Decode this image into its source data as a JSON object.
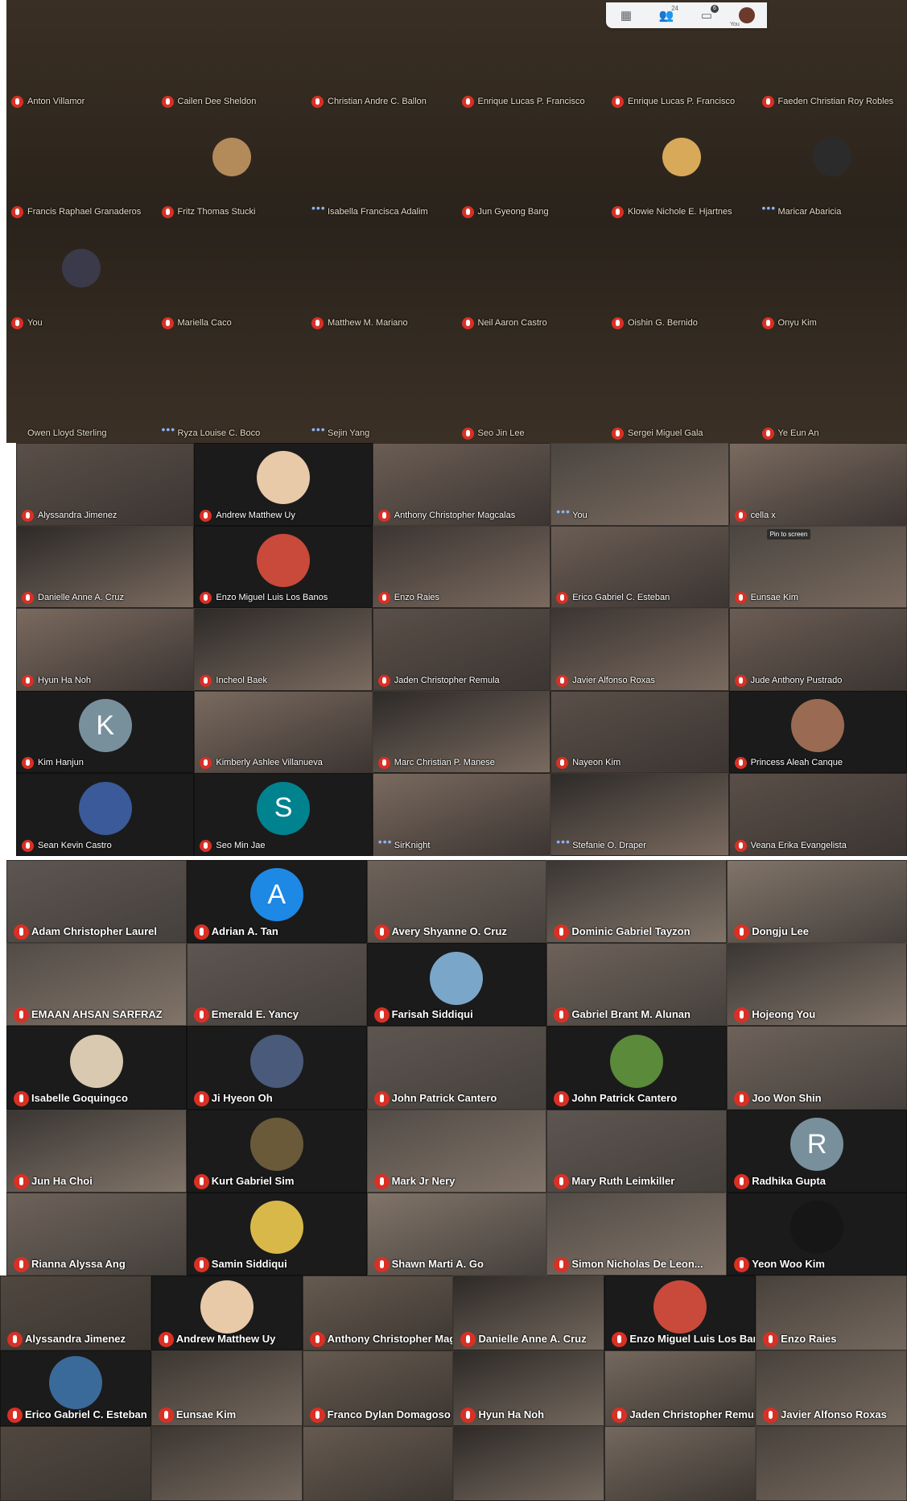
{
  "toolbar": {
    "people_count": "24",
    "chat_count": "6",
    "you_label": "You",
    "icons": [
      "grid-icon",
      "people-icon",
      "chat-icon",
      "self-avatar"
    ]
  },
  "screens": [
    {
      "cols": 6,
      "tiles": [
        {
          "name": "Anton Villamor",
          "status": "muted"
        },
        {
          "name": "Cailen Dee Sheldon",
          "status": "muted"
        },
        {
          "name": "Christian Andre C. Ballon",
          "status": "muted"
        },
        {
          "name": "Enrique Lucas P. Francisco",
          "status": "muted"
        },
        {
          "name": "Enrique Lucas P. Francisco",
          "status": "muted"
        },
        {
          "name": "Faeden Christian Roy Robles",
          "status": "muted"
        },
        {
          "name": "Francis Raphael Granaderos",
          "status": "muted"
        },
        {
          "name": "Fritz Thomas Stucki",
          "status": "muted",
          "avatar_color": "#b38a5a"
        },
        {
          "name": "Isabella Francisca Adalim",
          "status": "speaking"
        },
        {
          "name": "Jun Gyeong Bang",
          "status": "muted"
        },
        {
          "name": "Klowie Nichole E. Hjartnes",
          "status": "muted",
          "avatar_color": "#d9a95a"
        },
        {
          "name": "Maricar Abaricia",
          "status": "speaking",
          "avatar_color": "#2b2b2b"
        },
        {
          "name": "You",
          "status": "muted",
          "avatar_color": "#3a3a4a"
        },
        {
          "name": "Mariella Caco",
          "status": "muted"
        },
        {
          "name": "Matthew M. Mariano",
          "status": "muted"
        },
        {
          "name": "Neil Aaron Castro",
          "status": "muted"
        },
        {
          "name": "Oishin G. Bernido",
          "status": "muted"
        },
        {
          "name": "Onyu Kim",
          "status": "muted"
        },
        {
          "name": "Owen Lloyd Sterling",
          "status": "none"
        },
        {
          "name": "Ryza Louise C. Boco",
          "status": "speaking"
        },
        {
          "name": "Sejin Yang",
          "status": "speaking"
        },
        {
          "name": "Seo Jin Lee",
          "status": "muted"
        },
        {
          "name": "Sergei Miguel Gala",
          "status": "muted"
        },
        {
          "name": "Ye Eun An",
          "status": "muted"
        }
      ]
    },
    {
      "cols": 5,
      "tiles": [
        {
          "name": "Alyssandra Jimenez",
          "status": "muted"
        },
        {
          "name": "Andrew Matthew Uy",
          "status": "muted",
          "avatar_color": "#e8c9a8"
        },
        {
          "name": "Anthony Christopher Magcalas",
          "status": "muted"
        },
        {
          "name": "You",
          "status": "speaking"
        },
        {
          "name": "cella x",
          "status": "muted"
        },
        {
          "name": "Danielle Anne A. Cruz",
          "status": "muted"
        },
        {
          "name": "Enzo Miguel Luis Los Banos",
          "status": "muted",
          "avatar_color": "#c94a3a"
        },
        {
          "name": "Enzo Raies",
          "status": "muted"
        },
        {
          "name": "Erico Gabriel C. Esteban",
          "status": "muted"
        },
        {
          "name": "Eunsae Kim",
          "status": "muted",
          "tooltip": "Pin to screen"
        },
        {
          "name": "Hyun Ha Noh",
          "status": "muted"
        },
        {
          "name": "Incheol Baek",
          "status": "muted"
        },
        {
          "name": "Jaden Christopher Remula",
          "status": "muted"
        },
        {
          "name": "Javier Alfonso Roxas",
          "status": "muted"
        },
        {
          "name": "Jude Anthony Pustrado",
          "status": "muted"
        },
        {
          "name": "Kim Hanjun",
          "status": "muted",
          "initial": "K",
          "avatar_color": "#78909c"
        },
        {
          "name": "Kimberly Ashlee Villanueva",
          "status": "muted"
        },
        {
          "name": "Marc Christian P. Manese",
          "status": "muted"
        },
        {
          "name": "Nayeon Kim",
          "status": "muted"
        },
        {
          "name": "Princess Aleah Canque",
          "status": "muted",
          "avatar_color": "#9b6a52"
        },
        {
          "name": "Sean Kevin Castro",
          "status": "muted",
          "avatar_color": "#3a5a9a"
        },
        {
          "name": "Seo Min Jae",
          "status": "muted",
          "initial": "S",
          "avatar_color": "#00838f"
        },
        {
          "name": "SirKnight",
          "status": "speaking"
        },
        {
          "name": "Stefanie O. Draper",
          "status": "speaking"
        },
        {
          "name": "Veana Erika Evangelista",
          "status": "muted"
        }
      ]
    },
    {
      "cols": 5,
      "tiles": [
        {
          "name": "Adam Christopher Laurel",
          "status": "muted"
        },
        {
          "name": "Adrian A. Tan",
          "status": "muted",
          "initial": "A",
          "avatar_color": "#1e88e5"
        },
        {
          "name": "Avery Shyanne O. Cruz",
          "status": "muted"
        },
        {
          "name": "Dominic Gabriel Tayzon",
          "status": "muted"
        },
        {
          "name": "Dongju Lee",
          "status": "muted"
        },
        {
          "name": "EMAAN AHSAN SARFRAZ",
          "status": "muted"
        },
        {
          "name": "Emerald E. Yancy",
          "status": "muted"
        },
        {
          "name": "Farisah Siddiqui",
          "status": "muted",
          "avatar_color": "#7aa6c9"
        },
        {
          "name": "Gabriel Brant M. Alunan",
          "status": "muted"
        },
        {
          "name": "Hojeong You",
          "status": "muted"
        },
        {
          "name": "Isabelle Goquingco",
          "status": "muted",
          "avatar_color": "#d8c9b0"
        },
        {
          "name": "Ji Hyeon Oh",
          "status": "muted",
          "avatar_color": "#4a5a7a"
        },
        {
          "name": "John Patrick Cantero",
          "status": "muted"
        },
        {
          "name": "John Patrick Cantero",
          "status": "muted",
          "avatar_color": "#5a8a3a"
        },
        {
          "name": "Joo Won Shin",
          "status": "muted"
        },
        {
          "name": "Jun Ha Choi",
          "status": "muted"
        },
        {
          "name": "Kurt Gabriel Sim",
          "status": "muted",
          "avatar_color": "#6a5a3a"
        },
        {
          "name": "Mark Jr Nery",
          "status": "muted"
        },
        {
          "name": "Mary Ruth Leimkiller",
          "status": "muted"
        },
        {
          "name": "Radhika Gupta",
          "status": "muted",
          "initial": "R",
          "avatar_color": "#78909c"
        },
        {
          "name": "Rianna Alyssa Ang",
          "status": "muted"
        },
        {
          "name": "Samin Siddiqui",
          "status": "muted",
          "avatar_color": "#d9b84a"
        },
        {
          "name": "Shawn Marti A. Go",
          "status": "muted"
        },
        {
          "name": "Simon Nicholas De Leon...",
          "status": "muted"
        },
        {
          "name": "Yeon Woo Kim",
          "status": "muted",
          "avatar_color": "#161616"
        }
      ]
    },
    {
      "cols": 6,
      "tiles": [
        {
          "name": "Alyssandra Jimenez",
          "status": "muted"
        },
        {
          "name": "Andrew Matthew Uy",
          "status": "muted",
          "avatar_color": "#e8c9a8"
        },
        {
          "name": "Anthony Christopher Magca...",
          "status": "muted"
        },
        {
          "name": "Danielle Anne A. Cruz",
          "status": "muted"
        },
        {
          "name": "Enzo Miguel Luis Los Banos",
          "status": "muted",
          "avatar_color": "#c94a3a"
        },
        {
          "name": "Enzo Raies",
          "status": "muted"
        },
        {
          "name": "Erico Gabriel C. Esteban",
          "status": "muted",
          "avatar_color": "#3a6a9a"
        },
        {
          "name": "Eunsae Kim",
          "status": "muted"
        },
        {
          "name": "Franco Dylan Domagoso",
          "status": "muted"
        },
        {
          "name": "Hyun Ha Noh",
          "status": "muted"
        },
        {
          "name": "Jaden Christopher Remula",
          "status": "muted"
        },
        {
          "name": "Javier Alfonso Roxas",
          "status": "muted"
        },
        {
          "name": "",
          "status": "none"
        },
        {
          "name": "",
          "status": "none"
        },
        {
          "name": "",
          "status": "none"
        },
        {
          "name": "",
          "status": "none"
        },
        {
          "name": "",
          "status": "none"
        },
        {
          "name": "",
          "status": "none"
        }
      ]
    }
  ]
}
